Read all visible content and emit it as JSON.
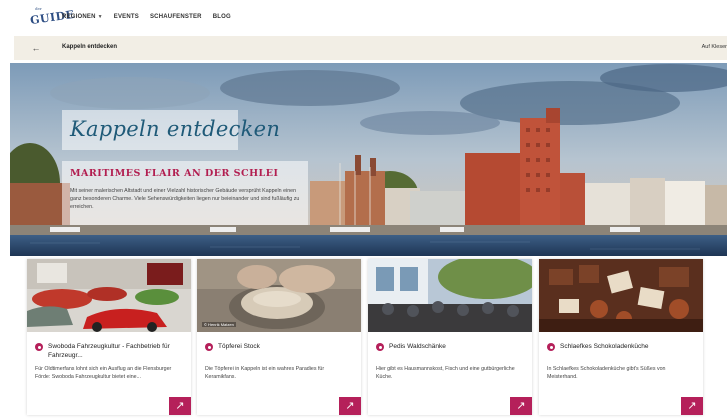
{
  "nav": {
    "logo_small": "der",
    "logo_big": "GUIDE",
    "items": [
      {
        "label": "REGIONEN",
        "has_dropdown": true
      },
      {
        "label": "EVENTS",
        "has_dropdown": false
      },
      {
        "label": "SCHAUFENSTER",
        "has_dropdown": false
      },
      {
        "label": "BLOG",
        "has_dropdown": false
      }
    ]
  },
  "subbar": {
    "back_icon": "arrow-left-icon",
    "title": "Kappeln entdecken",
    "right_text": "Auf Kleser"
  },
  "hero": {
    "title": "Kappeln entdecken",
    "subtitle": "Maritimes Flair an der Schlei",
    "text": "Mit seiner malerischen Altstadt und einer Vielzahl historischer Gebäude versprüht Kappeln einen ganz besonderen Charme. Viele Sehenswürdigkeiten liegen nur beieinander und sind fußläufig zu erreichen."
  },
  "cards": [
    {
      "title": "Swoboda Fahrzeugkultur - Fachbetrieb für Fahrzeugr...",
      "desc": "Für Oldtimerfans lohnt sich ein Ausflug an die Flensburger Förde: Swoboda Fahrzeugkultur bietet eine...",
      "image": "car-showroom",
      "credit": ""
    },
    {
      "title": "Töpferei Stock",
      "desc": "Die Töpferei in Kappeln ist ein wahres Paradies für Keramikfans.",
      "image": "pottery-wheel",
      "credit": "© Henrik Matzen"
    },
    {
      "title": "Pedis Waldschänke",
      "desc": "Hier gibt es Hausmannskost, Fisch und eine gutbürgerliche Küche.",
      "image": "beer-garden",
      "credit": ""
    },
    {
      "title": "Schlaefkes Schokoladenküche",
      "desc": "In Schlaefkes Schokoladenküche gibt's Süßes von Meisterhand.",
      "image": "chocolates",
      "credit": ""
    }
  ],
  "colors": {
    "accent": "#b5205a",
    "hero_title": "#1f5a78",
    "subbar_bg": "#f2eee5"
  }
}
